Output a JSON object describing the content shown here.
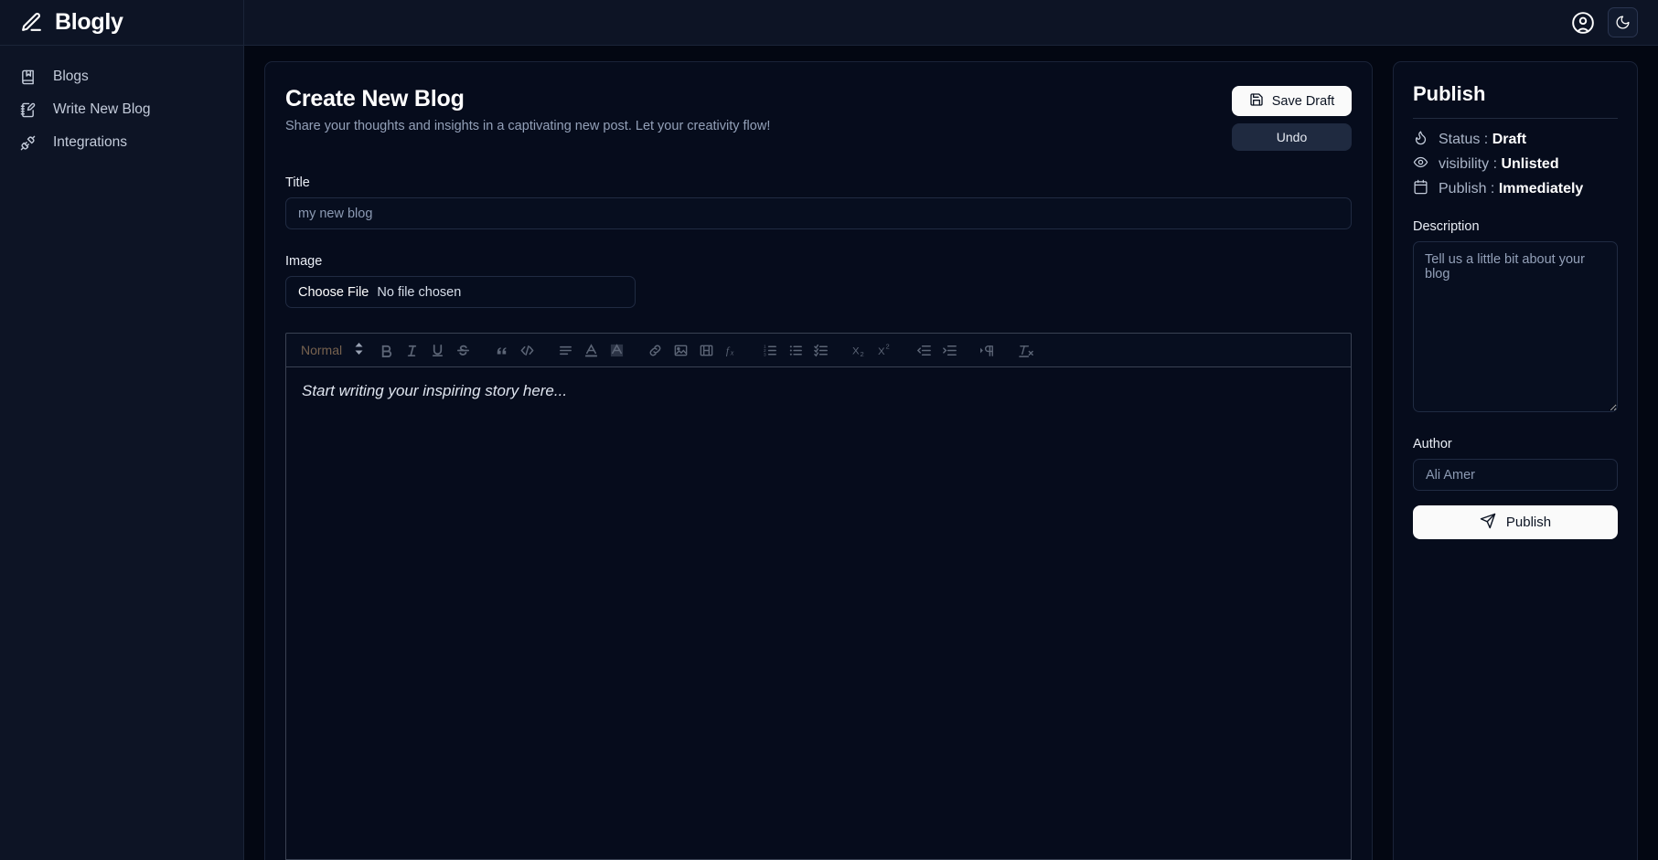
{
  "brand": {
    "name": "Blogly",
    "icon": "pen-line-icon"
  },
  "sidebar": {
    "items": [
      {
        "label": "Blogs",
        "icon": "book-marked-icon"
      },
      {
        "label": "Write New Blog",
        "icon": "notebook-pen-icon"
      },
      {
        "label": "Integrations",
        "icon": "unplug-icon"
      }
    ]
  },
  "topbar": {
    "account_icon": "circle-user-icon",
    "theme_icon": "moon-icon"
  },
  "main": {
    "title": "Create New Blog",
    "subtitle": "Share your thoughts and insights in a captivating new post. Let your creativity flow!",
    "save_draft_label": "Save Draft",
    "save_draft_icon": "save-icon",
    "undo_label": "Undo",
    "title_field": {
      "label": "Title",
      "placeholder": "my new blog",
      "value": ""
    },
    "image_field": {
      "label": "Image",
      "choose_file_label": "Choose File",
      "file_status": "No file chosen"
    },
    "editor": {
      "format_picker": "Normal",
      "placeholder": "Start writing your inspiring story here...",
      "tools": [
        "bold",
        "italic",
        "underline",
        "strike",
        "blockquote",
        "code-block",
        "align",
        "color",
        "background",
        "link",
        "image",
        "video",
        "formula",
        "list-ordered",
        "list-bullet",
        "list-check",
        "subscript",
        "superscript",
        "outdent",
        "indent",
        "direction",
        "clean"
      ]
    }
  },
  "publish": {
    "title": "Publish",
    "meta": [
      {
        "icon": "flame-icon",
        "label": "Status :",
        "value": "Draft"
      },
      {
        "icon": "eye-icon",
        "label": "visibility :",
        "value": "Unlisted"
      },
      {
        "icon": "calendar-icon",
        "label": "Publish :",
        "value": "Immediately"
      }
    ],
    "description_label": "Description",
    "description_placeholder": "Tell us a little bit about your blog",
    "description_value": "",
    "author_label": "Author",
    "author_placeholder": "Ali Amer",
    "author_value": "",
    "publish_button_label": "Publish",
    "publish_button_icon": "send-icon"
  },
  "colors": {
    "page_bg": "#030712",
    "sidebar_bg": "#0d1425",
    "card_bg": "#060c1c",
    "border": "#1a2338",
    "accent_white": "#fafafa",
    "muted_text": "#93a0b8"
  }
}
